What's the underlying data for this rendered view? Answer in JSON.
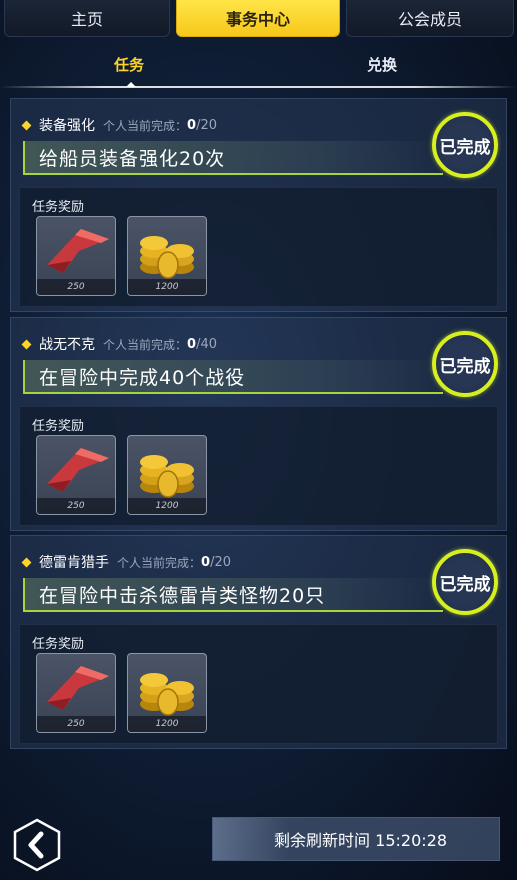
{
  "top_tabs": [
    {
      "label": "主页"
    },
    {
      "label": "事务中心"
    },
    {
      "label": "公会成员"
    }
  ],
  "sub_tabs": [
    {
      "label": "任务"
    },
    {
      "label": "兑换"
    }
  ],
  "tasks": [
    {
      "name": "装备强化",
      "progress_label": "个人当前完成：",
      "progress_current": "0",
      "progress_total": "/20",
      "description": "给船员装备强化20次",
      "status": "已完成",
      "reward_label": "任务奖励",
      "rewards": [
        {
          "icon": "red-crystal-icon",
          "count": "250"
        },
        {
          "icon": "gold-coins-icon",
          "count": "1200"
        }
      ]
    },
    {
      "name": "战无不克",
      "progress_label": "个人当前完成：",
      "progress_current": "0",
      "progress_total": "/40",
      "description": "在冒险中完成40个战役",
      "status": "已完成",
      "reward_label": "任务奖励",
      "rewards": [
        {
          "icon": "red-crystal-icon",
          "count": "250"
        },
        {
          "icon": "gold-coins-icon",
          "count": "1200"
        }
      ]
    },
    {
      "name": "德雷肯猎手",
      "progress_label": "个人当前完成：",
      "progress_current": "0",
      "progress_total": "/20",
      "description": "在冒险中击杀德雷肯类怪物20只",
      "status": "已完成",
      "reward_label": "任务奖励",
      "rewards": [
        {
          "icon": "red-crystal-icon",
          "count": "250"
        },
        {
          "icon": "gold-coins-icon",
          "count": "1200"
        }
      ]
    }
  ],
  "footer": {
    "back_icon": "chevron-left-icon",
    "refresh_text": "剩余刷新时间 15:20:28"
  },
  "colors": {
    "accent_yellow": "#ffd428",
    "badge_ring": "#d7ef1f",
    "desc_underline": "#a8d63a"
  }
}
